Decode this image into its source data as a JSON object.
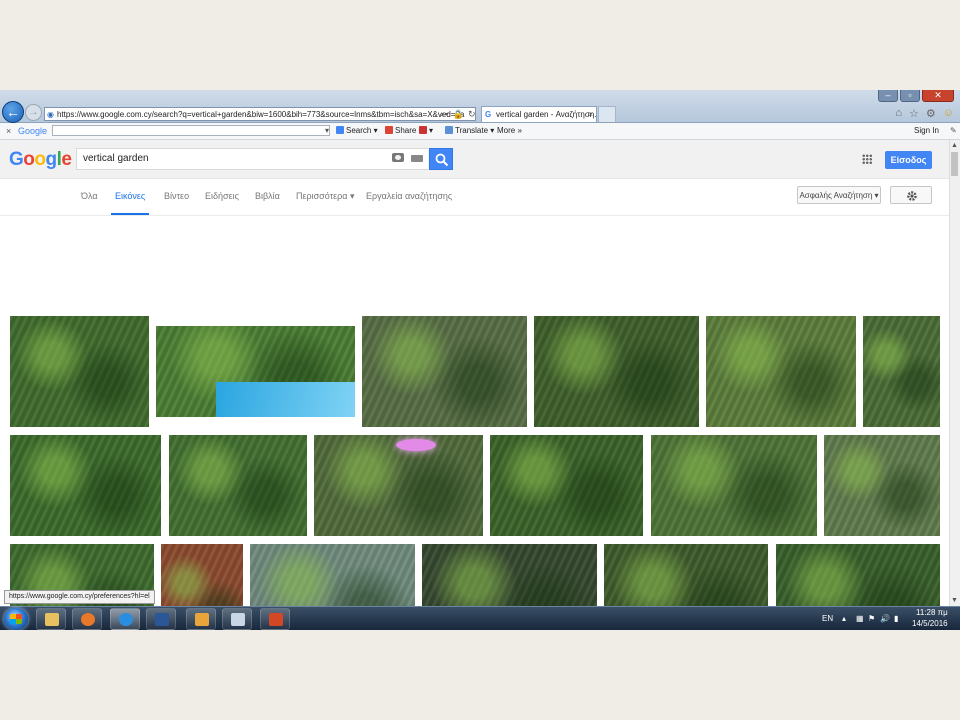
{
  "browser": {
    "address_url": "https://www.google.com.cy/search?q=vertical+garden&biw=1600&bih=773&source=lnms&tbm=isch&sa=X&ved=0a",
    "tab_title": "vertical garden - Αναζήτηση...",
    "controls": {
      "minimize": "–",
      "maximize": "▫",
      "close": "✕"
    }
  },
  "toolbar": {
    "close": "×",
    "logo": "Google",
    "search_label": "Search",
    "share_label": "Share",
    "translate_label": "Translate",
    "more_label": "More »",
    "signin_label": "Sign In"
  },
  "header": {
    "logo": "Google",
    "query": "vertical garden",
    "signin": "Είσοδος"
  },
  "tabs": [
    {
      "label": "Όλα",
      "active": false
    },
    {
      "label": "Εικόνες",
      "active": true
    },
    {
      "label": "Βίντεο",
      "active": false
    },
    {
      "label": "Ειδήσεις",
      "active": false
    },
    {
      "label": "Βιβλία",
      "active": false
    },
    {
      "label": "Περισσότερα ▾",
      "active": false
    },
    {
      "label": "Εργαλεία αναζήτησης",
      "active": false
    }
  ],
  "safe_search": "Ασφαλής Αναζήτηση ▾",
  "status_url": "https://www.google.com.cy/preferences?hl=el",
  "thumbnail_colors": [
    "#3f6a2c",
    "#4a7d33",
    "#566c44",
    "#3e5e2a",
    "#5b7c3b",
    "#496b35",
    "#3b6a2a",
    "#416f30",
    "#50693b",
    "#3a6228",
    "#4d7236",
    "#607a4c",
    "#3d6a2d",
    "#8a4a2e",
    "#6f8a7c",
    "#35482f",
    "#3e5a2b",
    "#385e2a",
    "#4a6b39",
    "#4e6b43",
    "#5b6a4e",
    "#4a5e3b",
    "#3e5f2a"
  ],
  "taskbar": {
    "lang": "EN",
    "time": "11:28 πμ",
    "date": "14/5/2016"
  }
}
